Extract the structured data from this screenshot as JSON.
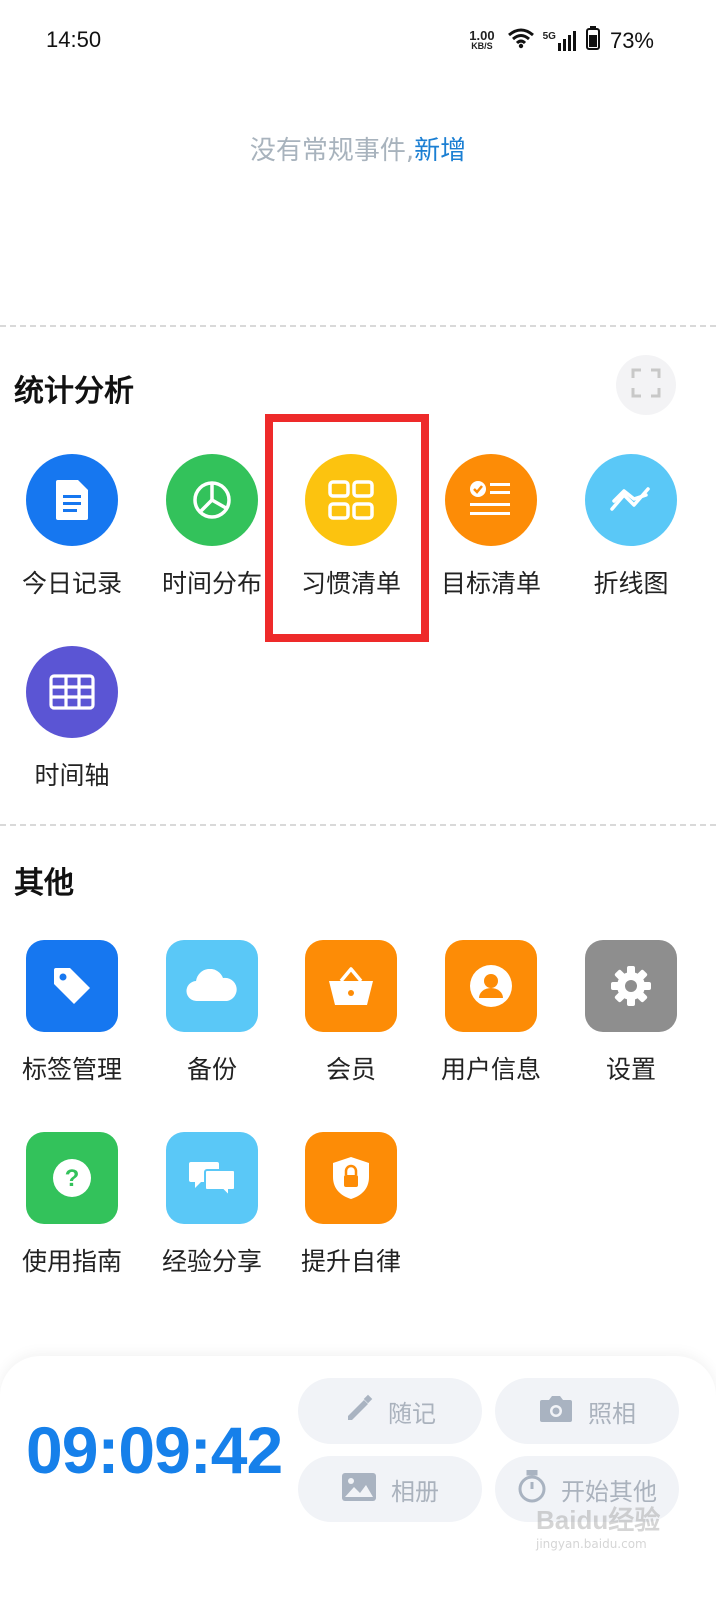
{
  "status_bar": {
    "time": "14:50",
    "net_speed_value": "1.00",
    "net_speed_unit": "KB/S",
    "signal_label": "5G",
    "battery_percent": "73%"
  },
  "empty_state": {
    "message": "没有常规事件,",
    "action_link": "新增"
  },
  "stats_section": {
    "title": "统计分析",
    "items": [
      {
        "label": "今日记录",
        "icon": "document-icon",
        "color": "#1677f0"
      },
      {
        "label": "时间分布",
        "icon": "pie-chart-icon",
        "color": "#33c25b"
      },
      {
        "label": "习惯清单",
        "icon": "grid-icon",
        "color": "#fcc30f"
      },
      {
        "label": "目标清单",
        "icon": "checklist-icon",
        "color": "#fd8c06"
      },
      {
        "label": "折线图",
        "icon": "line-chart-icon",
        "color": "#5ac8f7"
      },
      {
        "label": "时间轴",
        "icon": "table-icon",
        "color": "#5b55d4"
      }
    ]
  },
  "other_section": {
    "title": "其他",
    "items": [
      {
        "label": "标签管理",
        "icon": "tag-icon",
        "color": "#1677f0"
      },
      {
        "label": "备份",
        "icon": "cloud-icon",
        "color": "#5ac8f7"
      },
      {
        "label": "会员",
        "icon": "basket-icon",
        "color": "#fd8c06"
      },
      {
        "label": "用户信息",
        "icon": "user-icon",
        "color": "#fd8c06"
      },
      {
        "label": "设置",
        "icon": "gear-icon",
        "color": "#8e8e8e"
      },
      {
        "label": "使用指南",
        "icon": "question-icon",
        "color": "#33c25b"
      },
      {
        "label": "经验分享",
        "icon": "chat-icon",
        "color": "#5ac8f7"
      },
      {
        "label": "提升自律",
        "icon": "shield-lock-icon",
        "color": "#fd8c06"
      }
    ]
  },
  "bottom_panel": {
    "clock": "09:09:42",
    "buttons": {
      "note": "随记",
      "camera": "照相",
      "album": "相册",
      "start_other": "开始其他"
    }
  },
  "highlight_color": "#ee2a2a",
  "watermark": {
    "big": "Baidu经验",
    "small": "jingyan.baidu.com"
  }
}
